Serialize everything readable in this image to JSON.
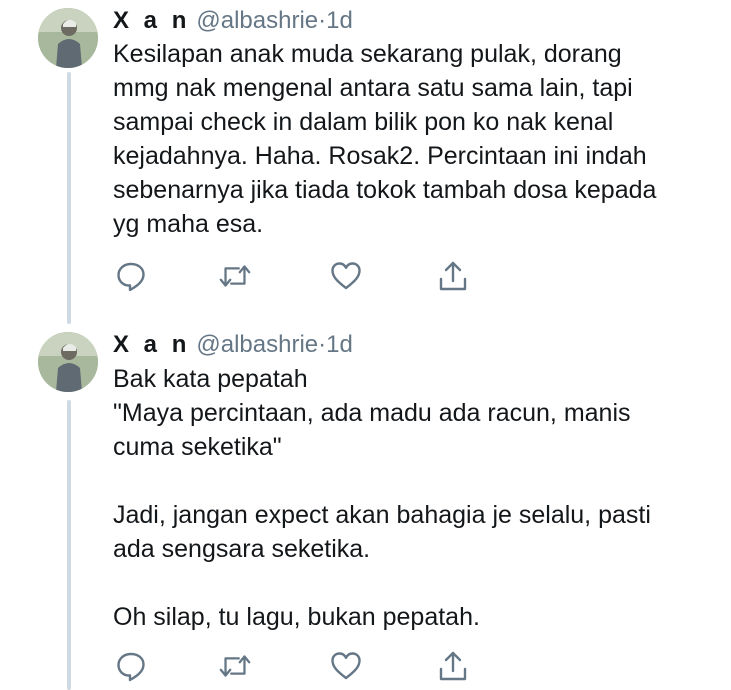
{
  "tweets": [
    {
      "author_name": "X a n",
      "handle": "@albashrie",
      "separator": "·",
      "time": "1d",
      "text": "Kesilapan anak muda sekarang pulak, dorang\nmmg nak mengenal antara satu sama lain, tapi\nsampai check in dalam bilik pon ko nak kenal\nkejadahnya. Haha. Rosak2. Percintaan ini indah\nsebenarnya jika tiada tokok tambah dosa kepada\nyg maha esa."
    },
    {
      "author_name": "X a n",
      "handle": "@albashrie",
      "separator": "·",
      "time": "1d",
      "text": "Bak kata pepatah\n\"Maya percintaan, ada madu ada racun, manis\ncuma seketika\"\n\nJadi, jangan expect akan bahagia je selalu, pasti\nada sengsara seketika.\n\nOh silap, tu lagu, bukan pepatah."
    }
  ],
  "colors": {
    "icon": "#657786",
    "thread_line": "#d0dae2",
    "text": "#14171a"
  },
  "icons": [
    "reply-icon",
    "retweet-icon",
    "like-icon",
    "share-icon"
  ]
}
